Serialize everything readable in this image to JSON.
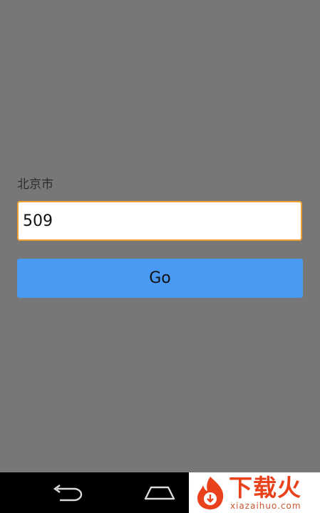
{
  "form": {
    "city_label": "北京市",
    "input_value": "509",
    "go_label": "Go"
  },
  "nav": {
    "back_icon": "back-arrow-icon",
    "home_icon": "home-icon"
  },
  "watermark": {
    "title": "下载火",
    "domain": "xiazaihuo.com"
  },
  "colors": {
    "background": "#777777",
    "input_border": "#f0a030",
    "button": "#4a9af4",
    "nav_bar": "#000000",
    "watermark_red": "#e8411c"
  }
}
